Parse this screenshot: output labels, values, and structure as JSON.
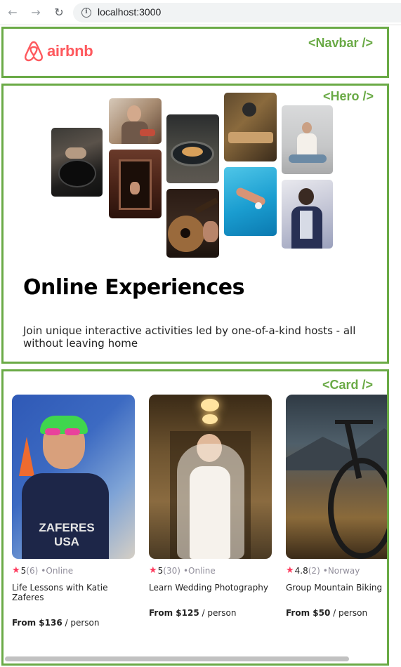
{
  "browser": {
    "url": "localhost:3000",
    "back_icon": "arrow-left-icon",
    "forward_icon": "arrow-right-icon",
    "reload_icon": "reload-icon",
    "info_icon": "info-icon"
  },
  "labels": {
    "navbar": "<Navbar />",
    "hero": "<Hero />",
    "card": "<Card />"
  },
  "colors": {
    "brand": "#fe595e",
    "component_outline": "#6aaa46",
    "star": "#fe395c",
    "muted": "#918e9b"
  },
  "navbar": {
    "logo_text": "airbnb",
    "logo_icon": "airbnb-logo-icon"
  },
  "hero": {
    "title": "Online Experiences",
    "subtitle": "Join unique interactive activities led by one-of-a-kind hosts - all without leaving home",
    "photos": [
      "cooking",
      "woman-with-food",
      "dancer-in-doorway",
      "food-bowl",
      "guitar",
      "microphone-performer",
      "swimmer",
      "yoga-meditation",
      "singer"
    ]
  },
  "cards": [
    {
      "rating": "5",
      "review_count": "(6)",
      "location": "•Online",
      "title": "Life Lessons with Katie Zaferes",
      "price": "From $136",
      "per": " / person",
      "image": "athlete-photo"
    },
    {
      "rating": "5",
      "review_count": "(30)",
      "location": "•Online",
      "title": "Learn Wedding Photography",
      "price": "From $125",
      "per": " / person",
      "image": "bride-photo"
    },
    {
      "rating": "4.8",
      "review_count": "(2)",
      "location": "•Norway",
      "title": "Group Mountain Biking",
      "price": "From $50",
      "per": " / person",
      "image": "mountain-bike-photo"
    }
  ]
}
